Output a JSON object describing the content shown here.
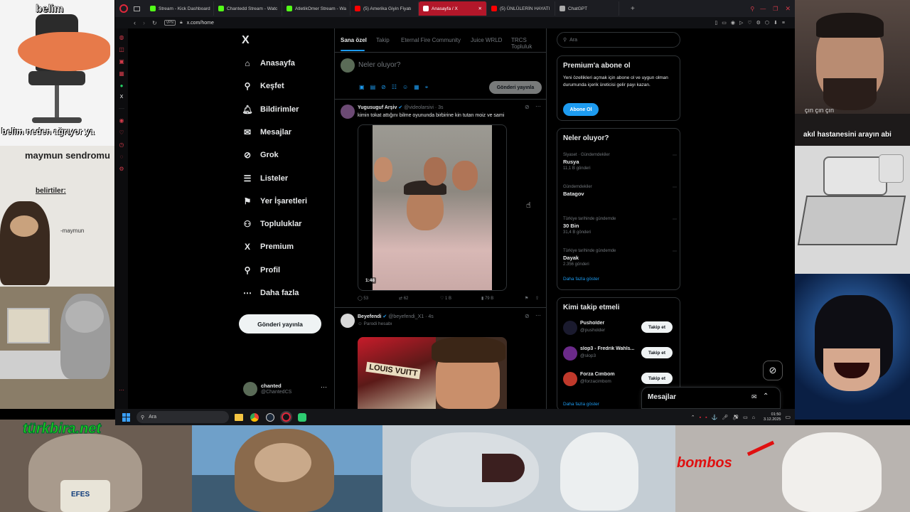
{
  "overlays": {
    "top_left_title": "belim",
    "top_left_caption": "belim neden ağrıyor ya",
    "syndrome_title": "maymun sendromu",
    "syndrome_symptoms": "belirtiler:",
    "syndrome_sign": "-maymun",
    "webcam_caption_1": "çın çın çın",
    "webcam_caption_2": "akıl hastanesini arayın abi",
    "bottom_logo": "türkbira.net",
    "bottom_cup_text": "EFES",
    "bottom_right_text": "bombos"
  },
  "browser": {
    "tabs": [
      {
        "label": "Stream - Kick Dashboard",
        "color": "#53fc18"
      },
      {
        "label": "Chantedd Stream - Watc",
        "color": "#53fc18"
      },
      {
        "label": "AtletikOmer Stream - Wa",
        "color": "#53fc18"
      },
      {
        "label": "(5) Amerika Giyin Fiyatı",
        "color": "#ff0000"
      },
      {
        "label": "Anasayfa / X",
        "color": "#ffffff"
      },
      {
        "label": "(5) ÜNLÜLERİN HAYATI",
        "color": "#ff0000"
      },
      {
        "label": "ChatGPT",
        "color": "#aaaaaa"
      }
    ],
    "url": "x.com/home",
    "vpn": "VPN"
  },
  "x": {
    "logo": "X",
    "nav": [
      {
        "label": "Anasayfa",
        "icon": "home-icon",
        "glyph": "⌂"
      },
      {
        "label": "Keşfet",
        "icon": "search-icon",
        "glyph": "⚲"
      },
      {
        "label": "Bildirimler",
        "icon": "bell-icon",
        "glyph": "🔔︎"
      },
      {
        "label": "Mesajlar",
        "icon": "envelope-icon",
        "glyph": "✉"
      },
      {
        "label": "Grok",
        "icon": "grok-icon",
        "glyph": "⊘"
      },
      {
        "label": "Listeler",
        "icon": "list-icon",
        "glyph": "☰"
      },
      {
        "label": "Yer İşaretleri",
        "icon": "bookmark-icon",
        "glyph": "⚑"
      },
      {
        "label": "Topluluklar",
        "icon": "people-icon",
        "glyph": "⚇"
      },
      {
        "label": "Premium",
        "icon": "x-premium-icon",
        "glyph": "X"
      },
      {
        "label": "Profil",
        "icon": "person-icon",
        "glyph": "⚲"
      },
      {
        "label": "Daha fazla",
        "icon": "more-circle-icon",
        "glyph": "⋯"
      }
    ],
    "post_button": "Gönderi yayınla",
    "account": {
      "name": "chanted",
      "handle": "@ChantedCS"
    },
    "feed_tabs": [
      "Sana özel",
      "Takip",
      "Eternal Fire Community",
      "Juice WRLD",
      "TRCS Topluluk"
    ],
    "composer": {
      "placeholder": "Neler oluyor?",
      "button": "Gönderi yayınla"
    },
    "posts": [
      {
        "name": "Yugusuguf Arşiv",
        "handle": "@videolarsivi · 3s",
        "text": "kimin tokat attığını bilme oyununda birbirine kin tutan moiz ve sami",
        "duration": "1:48",
        "replies": "53",
        "reposts": "62",
        "likes": "1 B",
        "views": "79 B"
      },
      {
        "name": "Beyefendi",
        "handle": "@beyefendi_X1 · 4s",
        "sub": "Parodi hesabı",
        "image_text": "LOUIS VUITT"
      }
    ],
    "search_placeholder": "Ara",
    "premium": {
      "title": "Premium'a abone ol",
      "body": "Yeni özellikleri açmak için abone ol ve uygun olman durumunda içerik üreticisi gelir payı kazan.",
      "button": "Abone Ol"
    },
    "trends_title": "Neler oluyor?",
    "trends": [
      {
        "context": "Siyaset · Gündemdekiler",
        "name": "Rusya",
        "count": "11,1 B gönderi"
      },
      {
        "context": "Gündemdekiler",
        "name": "Batagov",
        "count": ""
      },
      {
        "context": "Türkiye tarihinde gündemde",
        "name": "30 Bin",
        "count": "31,4 B gönderi"
      },
      {
        "context": "Türkiye tarihinde gündemde",
        "name": "Dayak",
        "count": "2.356 gönderi"
      }
    ],
    "show_more": "Daha fazla göster",
    "who_title": "Kimi takip etmeli",
    "who": [
      {
        "name": "Pusholder",
        "handle": "@pusholder",
        "button": "Takip et"
      },
      {
        "name": "slop3 - Fredrik Wahls...",
        "handle": "@slop3",
        "button": "Takip et"
      },
      {
        "name": "Forza Cimbom",
        "handle": "@forzacimbom",
        "button": "Takip et"
      }
    ],
    "who_more": "Daha fazla göster",
    "messages_label": "Mesajlar"
  },
  "taskbar": {
    "search": "Ara",
    "time": "01:50",
    "date": "3.12.2025"
  }
}
